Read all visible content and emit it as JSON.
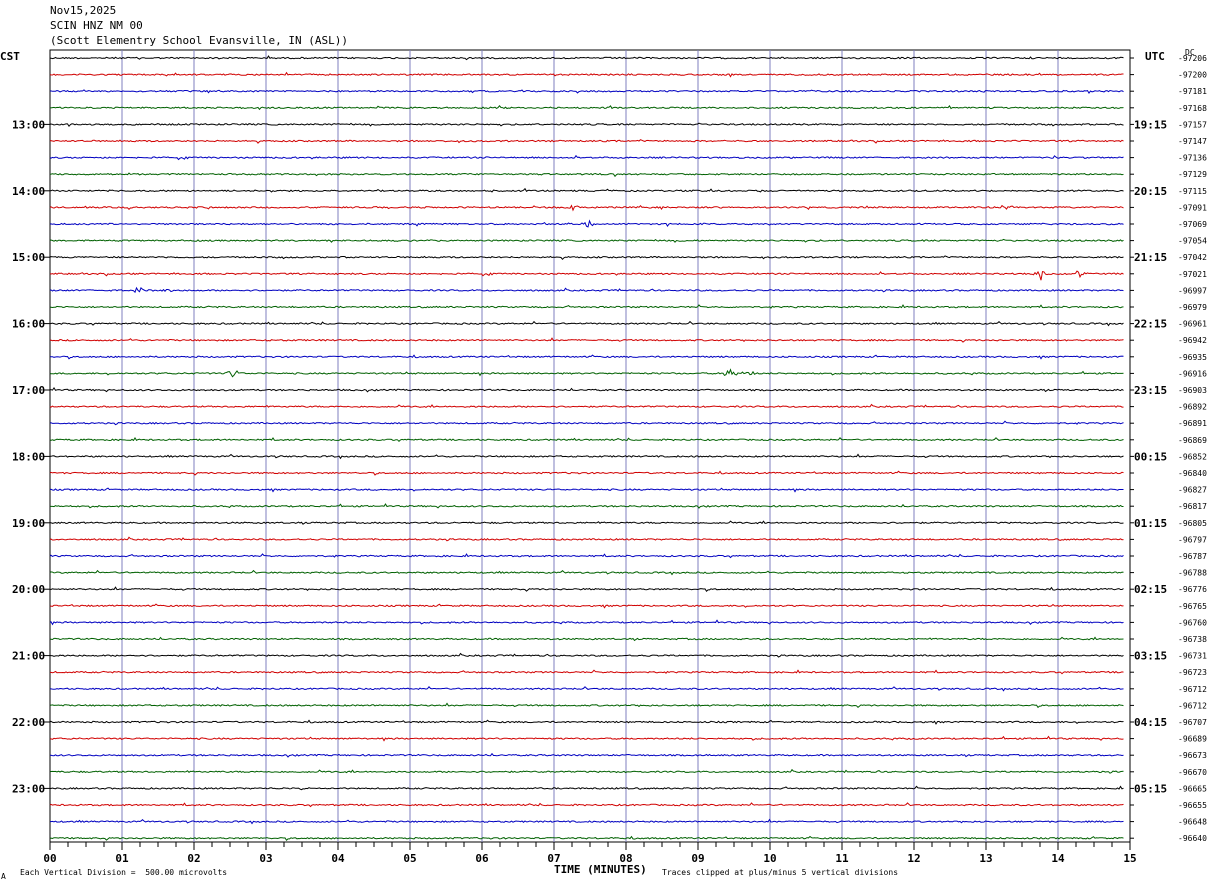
{
  "header": {
    "date": "Nov15,2025",
    "station": "SCIN HNZ NM 00",
    "location": "(Scott Elementry School Evansville, IN (ASL))"
  },
  "left_zone": "CST",
  "right_zone": "UTC",
  "dc_label": "DC",
  "footer": {
    "vertical_division": "Each Vertical Division =  500.00 microvolts",
    "clip_note": "Traces clipped at plus/minus 5 vertical divisions",
    "corner_mark": "A"
  },
  "colors": {
    "black": "#000000",
    "red": "#d00000",
    "blue": "#0000c0",
    "green": "#006000",
    "grid": "#7f7fbf"
  },
  "chart_data": {
    "type": "helicorder",
    "xlabel": "TIME (MINUTES)",
    "xlim": [
      0,
      15
    ],
    "x_ticks": [
      "00",
      "01",
      "02",
      "03",
      "04",
      "05",
      "06",
      "07",
      "08",
      "09",
      "10",
      "11",
      "12",
      "13",
      "14",
      "15"
    ],
    "trace_colors": [
      "black",
      "red",
      "blue",
      "green"
    ],
    "left_hour_labels": [
      {
        "trace": 4,
        "label": "13:00"
      },
      {
        "trace": 8,
        "label": "14:00"
      },
      {
        "trace": 12,
        "label": "15:00"
      },
      {
        "trace": 16,
        "label": "16:00"
      },
      {
        "trace": 20,
        "label": "17:00"
      },
      {
        "trace": 24,
        "label": "18:00"
      },
      {
        "trace": 28,
        "label": "19:00"
      },
      {
        "trace": 32,
        "label": "20:00"
      },
      {
        "trace": 36,
        "label": "21:00"
      },
      {
        "trace": 40,
        "label": "22:00"
      },
      {
        "trace": 44,
        "label": "23:00"
      }
    ],
    "right_hour_labels": [
      {
        "trace": 0,
        "label": "UTC"
      },
      {
        "trace": 4,
        "label": "19:15"
      },
      {
        "trace": 8,
        "label": "20:15"
      },
      {
        "trace": 12,
        "label": "21:15"
      },
      {
        "trace": 16,
        "label": "22:15"
      },
      {
        "trace": 20,
        "label": "23:15"
      },
      {
        "trace": 24,
        "label": "00:15"
      },
      {
        "trace": 28,
        "label": "01:15"
      },
      {
        "trace": 32,
        "label": "02:15"
      },
      {
        "trace": 36,
        "label": "03:15"
      },
      {
        "trace": 40,
        "label": "04:15"
      },
      {
        "trace": 44,
        "label": "05:15"
      }
    ],
    "dc_offsets": [
      "-97206",
      "-97200",
      "-97181",
      "-97168",
      "-97157",
      "-97147",
      "-97136",
      "-97129",
      "-97115",
      "-97091",
      "-97069",
      "-97054",
      "-97042",
      "-97021",
      "-96997",
      "-96979",
      "-96961",
      "-96942",
      "-96935",
      "-96916",
      "-96903",
      "-96892",
      "-96891",
      "-96869",
      "-96852",
      "-96840",
      "-96827",
      "-96817",
      "-96805",
      "-96797",
      "-96787",
      "-96788",
      "-96776",
      "-96765",
      "-96760",
      "-96738",
      "-96731",
      "-96723",
      "-96712",
      "-96712",
      "-96707",
      "-96689",
      "-96673",
      "-96670",
      "-96665",
      "-96655",
      "-96648",
      "-96640"
    ],
    "events": [
      {
        "trace": 9,
        "minute": 7.25,
        "amplitude": 0.4
      },
      {
        "trace": 9,
        "minute": 13.3,
        "amplitude": 0.8
      },
      {
        "trace": 10,
        "minute": 7.5,
        "amplitude": 0.6
      },
      {
        "trace": 13,
        "minute": 13.75,
        "amplitude": 1.0
      },
      {
        "trace": 13,
        "minute": 14.3,
        "amplitude": 0.6
      },
      {
        "trace": 14,
        "minute": 1.25,
        "amplitude": 0.6
      },
      {
        "trace": 14,
        "minute": 1.6,
        "amplitude": 0.5
      },
      {
        "trace": 19,
        "minute": 2.55,
        "amplitude": 0.6
      },
      {
        "trace": 19,
        "minute": 9.45,
        "amplitude": 0.7
      },
      {
        "trace": 19,
        "minute": 9.7,
        "amplitude": 0.5
      },
      {
        "trace": 44,
        "minute": 3.55,
        "amplitude": 0.3
      }
    ],
    "grid": true
  }
}
